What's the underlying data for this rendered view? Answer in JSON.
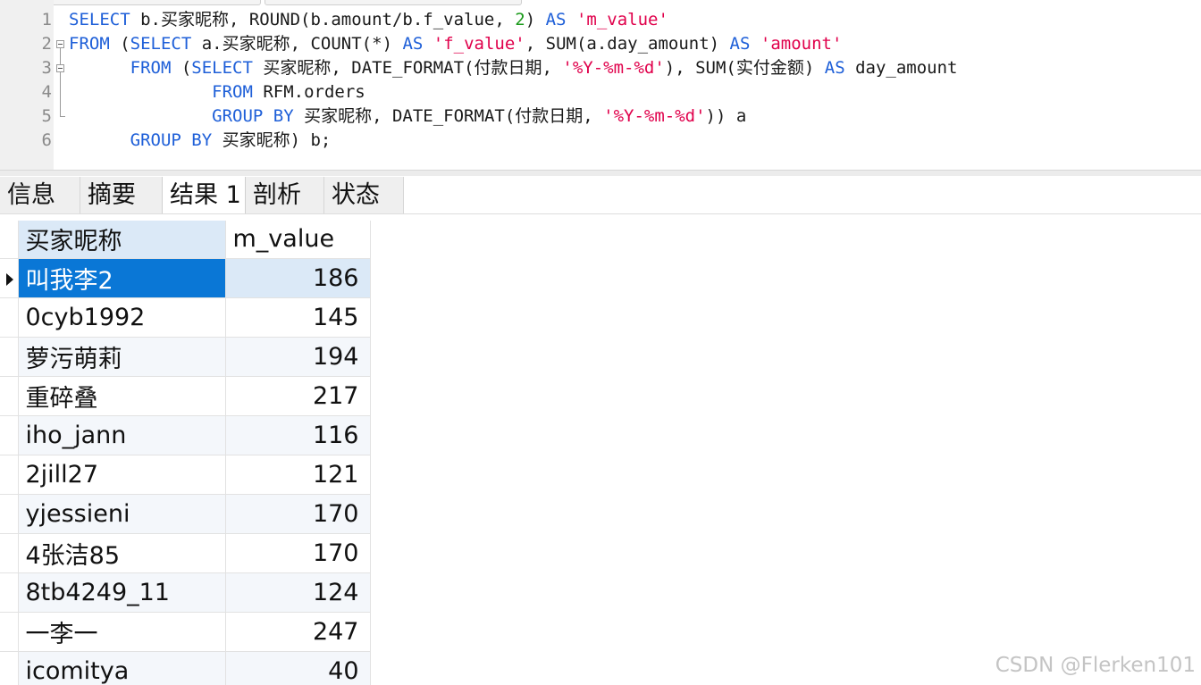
{
  "editor": {
    "line_numbers": [
      "1",
      "2",
      "3",
      "4",
      "5",
      "6"
    ],
    "lines": [
      [
        {
          "t": "SELECT",
          "c": "kw"
        },
        {
          "t": " b.买家昵称, ROUND(b.amount/b.f_value, ",
          "c": ""
        },
        {
          "t": "2",
          "c": "num"
        },
        {
          "t": ") ",
          "c": ""
        },
        {
          "t": "AS",
          "c": "kw"
        },
        {
          "t": " ",
          "c": ""
        },
        {
          "t": "'m_value'",
          "c": "str"
        }
      ],
      [
        {
          "t": "FROM",
          "c": "kw"
        },
        {
          "t": " (",
          "c": ""
        },
        {
          "t": "SELECT",
          "c": "kw"
        },
        {
          "t": " a.买家昵称, COUNT(*) ",
          "c": ""
        },
        {
          "t": "AS",
          "c": "kw"
        },
        {
          "t": " ",
          "c": ""
        },
        {
          "t": "'f_value'",
          "c": "str"
        },
        {
          "t": ", SUM(a.day_amount) ",
          "c": ""
        },
        {
          "t": "AS",
          "c": "kw"
        },
        {
          "t": " ",
          "c": ""
        },
        {
          "t": "'amount'",
          "c": "str"
        }
      ],
      [
        {
          "t": "      ",
          "c": ""
        },
        {
          "t": "FROM",
          "c": "kw"
        },
        {
          "t": " (",
          "c": ""
        },
        {
          "t": "SELECT",
          "c": "kw"
        },
        {
          "t": " 买家昵称, DATE_FORMAT(付款日期, ",
          "c": ""
        },
        {
          "t": "'%Y-%m-%d'",
          "c": "str"
        },
        {
          "t": "), SUM(实付金额) ",
          "c": ""
        },
        {
          "t": "AS",
          "c": "kw"
        },
        {
          "t": " day_amount",
          "c": ""
        }
      ],
      [
        {
          "t": "              ",
          "c": ""
        },
        {
          "t": "FROM",
          "c": "kw"
        },
        {
          "t": " RFM.orders",
          "c": ""
        }
      ],
      [
        {
          "t": "              ",
          "c": ""
        },
        {
          "t": "GROUP BY",
          "c": "kw"
        },
        {
          "t": " 买家昵称, DATE_FORMAT(付款日期, ",
          "c": ""
        },
        {
          "t": "'%Y-%m-%d'",
          "c": "str"
        },
        {
          "t": ")) a",
          "c": ""
        }
      ],
      [
        {
          "t": "      ",
          "c": ""
        },
        {
          "t": "GROUP BY",
          "c": "kw"
        },
        {
          "t": " 买家昵称) b;",
          "c": ""
        }
      ]
    ]
  },
  "tabs": [
    "信息",
    "摘要",
    "结果 1",
    "剖析",
    "状态"
  ],
  "active_tab": "结果 1",
  "grid": {
    "columns": [
      "买家昵称",
      "m_value"
    ],
    "rows": [
      [
        "叫我李2",
        "186"
      ],
      [
        "0cyb1992",
        "145"
      ],
      [
        "萝污萌莉",
        "194"
      ],
      [
        "重碎叠",
        "217"
      ],
      [
        "iho_jann",
        "116"
      ],
      [
        "2jill27",
        "121"
      ],
      [
        "yjessieni",
        "170"
      ],
      [
        "4张洁85",
        "170"
      ],
      [
        "8tb4249_11",
        "124"
      ],
      [
        "一李一",
        "247"
      ],
      [
        "icomitya",
        "40"
      ]
    ],
    "selected_row": 0
  },
  "watermark": "CSDN @Flerken101",
  "colors": {
    "keyword": "#1e5fd8",
    "string": "#e0004b",
    "number": "#1a9a1a",
    "selection": "#0a77d6"
  }
}
